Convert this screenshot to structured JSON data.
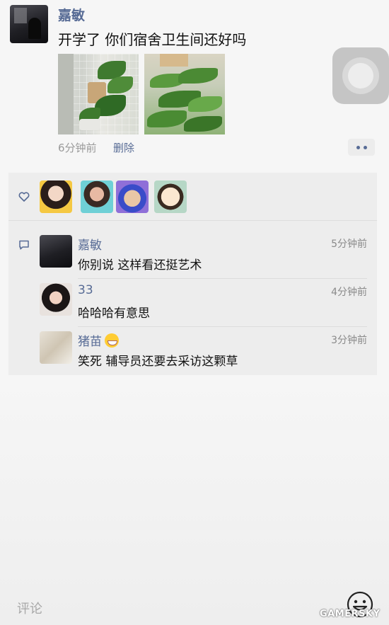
{
  "post": {
    "author": "嘉敏",
    "text": "开学了 你们宿舍卫生间还好吗",
    "time": "6分钟前",
    "delete_label": "删除",
    "photos": [
      "bathroom-plant-photo-1",
      "bathroom-plant-photo-2"
    ]
  },
  "likes": {
    "icon": "heart-icon",
    "avatars": [
      "like-avatar-1",
      "like-avatar-2",
      "like-avatar-3",
      "like-avatar-4"
    ]
  },
  "comments": [
    {
      "name": "嘉敏",
      "text": "你别说 这样看还挺艺术",
      "time": "5分钟前"
    },
    {
      "name": "33",
      "text": "哈哈哈有意思",
      "time": "4分钟前"
    },
    {
      "name": "猪苗",
      "text": "笑死 辅导员还要去采访这颗草",
      "time": "3分钟前",
      "emoji": "grinning-emoji"
    }
  ],
  "footer": {
    "comment_placeholder": "评论",
    "emoji_icon": "smiley-icon"
  },
  "watermark": "GAMERSKY",
  "colors": {
    "link": "#576b95",
    "background": "#f6f6f6",
    "interaction_panel": "#ededed",
    "muted_text": "#9a9a9a"
  }
}
